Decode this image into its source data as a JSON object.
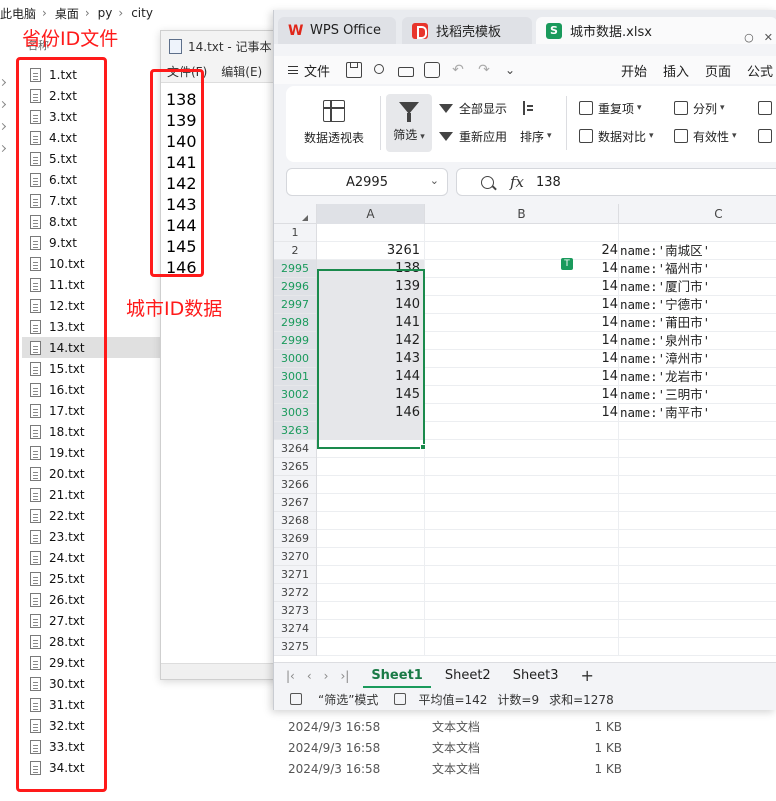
{
  "explorer": {
    "breadcrumb": [
      "此电脑",
      "桌面",
      "py",
      "city"
    ],
    "column_name": "名称",
    "files": [
      "1.txt",
      "2.txt",
      "3.txt",
      "4.txt",
      "5.txt",
      "6.txt",
      "7.txt",
      "8.txt",
      "9.txt",
      "10.txt",
      "11.txt",
      "12.txt",
      "13.txt",
      "14.txt",
      "15.txt",
      "16.txt",
      "17.txt",
      "18.txt",
      "19.txt",
      "20.txt",
      "21.txt",
      "22.txt",
      "23.txt",
      "24.txt",
      "25.txt",
      "26.txt",
      "27.txt",
      "28.txt",
      "29.txt",
      "30.txt",
      "31.txt",
      "32.txt",
      "33.txt",
      "34.txt"
    ],
    "selected_file": "14.txt",
    "detail_rows": [
      {
        "date": "2024/9/3 16:58",
        "type": "文本文档",
        "size": "1 KB"
      },
      {
        "date": "2024/9/3 16:58",
        "type": "文本文档",
        "size": "1 KB"
      },
      {
        "date": "2024/9/3 16:58",
        "type": "文本文档",
        "size": "1 KB"
      }
    ]
  },
  "notepad": {
    "title": "14.txt - 记事本",
    "menu": [
      "文件(F)",
      "编辑(E)"
    ],
    "lines": [
      "138",
      "139",
      "140",
      "141",
      "142",
      "143",
      "144",
      "145",
      "146"
    ]
  },
  "wps": {
    "tabs": {
      "wps": "WPS Office",
      "docer": "找稻壳模板",
      "sheet": "城市数据.xlsx",
      "sheet_logo": "S"
    },
    "menu": {
      "file": "文件",
      "ribbon_tabs": [
        "开始",
        "插入",
        "页面",
        "公式"
      ]
    },
    "ribbon": {
      "pivot": "数据透视表",
      "filter": "筛选",
      "show_all": "全部显示",
      "reapply": "重新应用",
      "sort": "排序",
      "dup": "重复项",
      "compare": "数据对比",
      "split": "分列",
      "validity": "有效性"
    },
    "name_box": "A2995",
    "fx_label": "fx",
    "formula_value": "138",
    "columns": [
      "A",
      "B",
      "C"
    ],
    "rows": [
      {
        "n": "1",
        "a": "",
        "b": "",
        "c": "",
        "hl": false
      },
      {
        "n": "2",
        "a": "3261",
        "b": "24",
        "c": "name:'南城区'",
        "hl": false
      },
      {
        "n": "2995",
        "a": "138",
        "b": "14",
        "c": "name:'福州市'",
        "hl": true
      },
      {
        "n": "2996",
        "a": "139",
        "b": "14",
        "c": "name:'厦门市'",
        "hl": true
      },
      {
        "n": "2997",
        "a": "140",
        "b": "14",
        "c": "name:'宁德市'",
        "hl": true
      },
      {
        "n": "2998",
        "a": "141",
        "b": "14",
        "c": "name:'莆田市'",
        "hl": true
      },
      {
        "n": "2999",
        "a": "142",
        "b": "14",
        "c": "name:'泉州市'",
        "hl": true
      },
      {
        "n": "3000",
        "a": "143",
        "b": "14",
        "c": "name:'漳州市'",
        "hl": true
      },
      {
        "n": "3001",
        "a": "144",
        "b": "14",
        "c": "name:'龙岩市'",
        "hl": true
      },
      {
        "n": "3002",
        "a": "145",
        "b": "14",
        "c": "name:'三明市'",
        "hl": true
      },
      {
        "n": "3003",
        "a": "146",
        "b": "14",
        "c": "name:'南平市'",
        "hl": true
      },
      {
        "n": "3263",
        "a": "",
        "b": "",
        "c": "",
        "hl": true
      },
      {
        "n": "3264",
        "a": "",
        "b": "",
        "c": "",
        "hl": false
      },
      {
        "n": "3265",
        "a": "",
        "b": "",
        "c": "",
        "hl": false
      },
      {
        "n": "3266",
        "a": "",
        "b": "",
        "c": "",
        "hl": false
      },
      {
        "n": "3267",
        "a": "",
        "b": "",
        "c": "",
        "hl": false
      },
      {
        "n": "3268",
        "a": "",
        "b": "",
        "c": "",
        "hl": false
      },
      {
        "n": "3269",
        "a": "",
        "b": "",
        "c": "",
        "hl": false
      },
      {
        "n": "3270",
        "a": "",
        "b": "",
        "c": "",
        "hl": false
      },
      {
        "n": "3271",
        "a": "",
        "b": "",
        "c": "",
        "hl": false
      },
      {
        "n": "3272",
        "a": "",
        "b": "",
        "c": "",
        "hl": false
      },
      {
        "n": "3273",
        "a": "",
        "b": "",
        "c": "",
        "hl": false
      },
      {
        "n": "3274",
        "a": "",
        "b": "",
        "c": "",
        "hl": false
      },
      {
        "n": "3275",
        "a": "",
        "b": "",
        "c": "",
        "hl": false
      }
    ],
    "filter_marker": "T",
    "sheet_tabs": [
      "Sheet1",
      "Sheet2",
      "Sheet3"
    ],
    "add_sheet": "+",
    "status": {
      "mode": "“筛选”模式",
      "avg": "平均值=142",
      "count": "计数=9",
      "sum": "求和=1278"
    }
  },
  "annotations": {
    "province_label": "省份ID文件",
    "city_label": "城市ID数据",
    "color": "#ff1a1a"
  }
}
